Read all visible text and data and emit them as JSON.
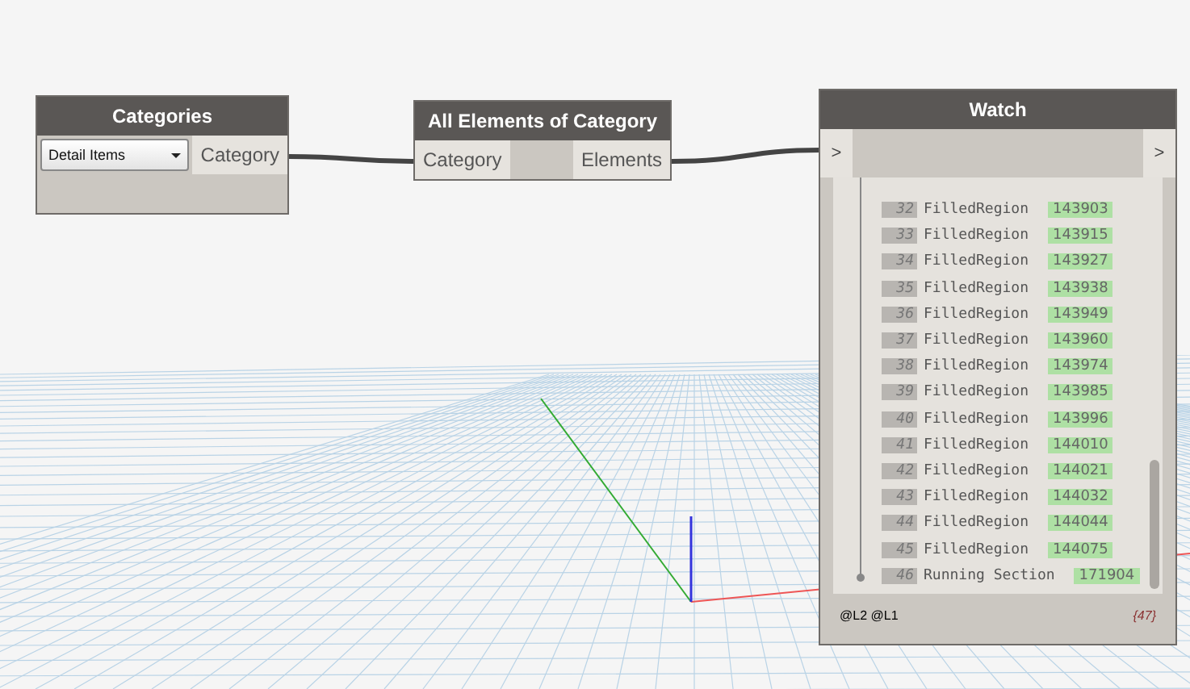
{
  "categories_node": {
    "title": "Categories",
    "dropdown": {
      "value": "Detail Items"
    },
    "output": "Category"
  },
  "elements_node": {
    "title": "All Elements of Category",
    "input": "Category",
    "output": "Elements"
  },
  "watch_node": {
    "title": "Watch",
    "left_toggle": ">",
    "right_toggle": ">",
    "items": [
      {
        "index": "32",
        "name": "FilledRegion",
        "value": "143903"
      },
      {
        "index": "33",
        "name": "FilledRegion",
        "value": "143915"
      },
      {
        "index": "34",
        "name": "FilledRegion",
        "value": "143927"
      },
      {
        "index": "35",
        "name": "FilledRegion",
        "value": "143938"
      },
      {
        "index": "36",
        "name": "FilledRegion",
        "value": "143949"
      },
      {
        "index": "37",
        "name": "FilledRegion",
        "value": "143960"
      },
      {
        "index": "38",
        "name": "FilledRegion",
        "value": "143974"
      },
      {
        "index": "39",
        "name": "FilledRegion",
        "value": "143985"
      },
      {
        "index": "40",
        "name": "FilledRegion",
        "value": "143996"
      },
      {
        "index": "41",
        "name": "FilledRegion",
        "value": "144010"
      },
      {
        "index": "42",
        "name": "FilledRegion",
        "value": "144021"
      },
      {
        "index": "43",
        "name": "FilledRegion",
        "value": "144032"
      },
      {
        "index": "44",
        "name": "FilledRegion",
        "value": "144044"
      },
      {
        "index": "45",
        "name": "FilledRegion",
        "value": "144075"
      },
      {
        "index": "46",
        "name": "Running Section",
        "value": "171904"
      }
    ],
    "levels": [
      "@L2",
      "@L1"
    ],
    "count": "{47}"
  }
}
